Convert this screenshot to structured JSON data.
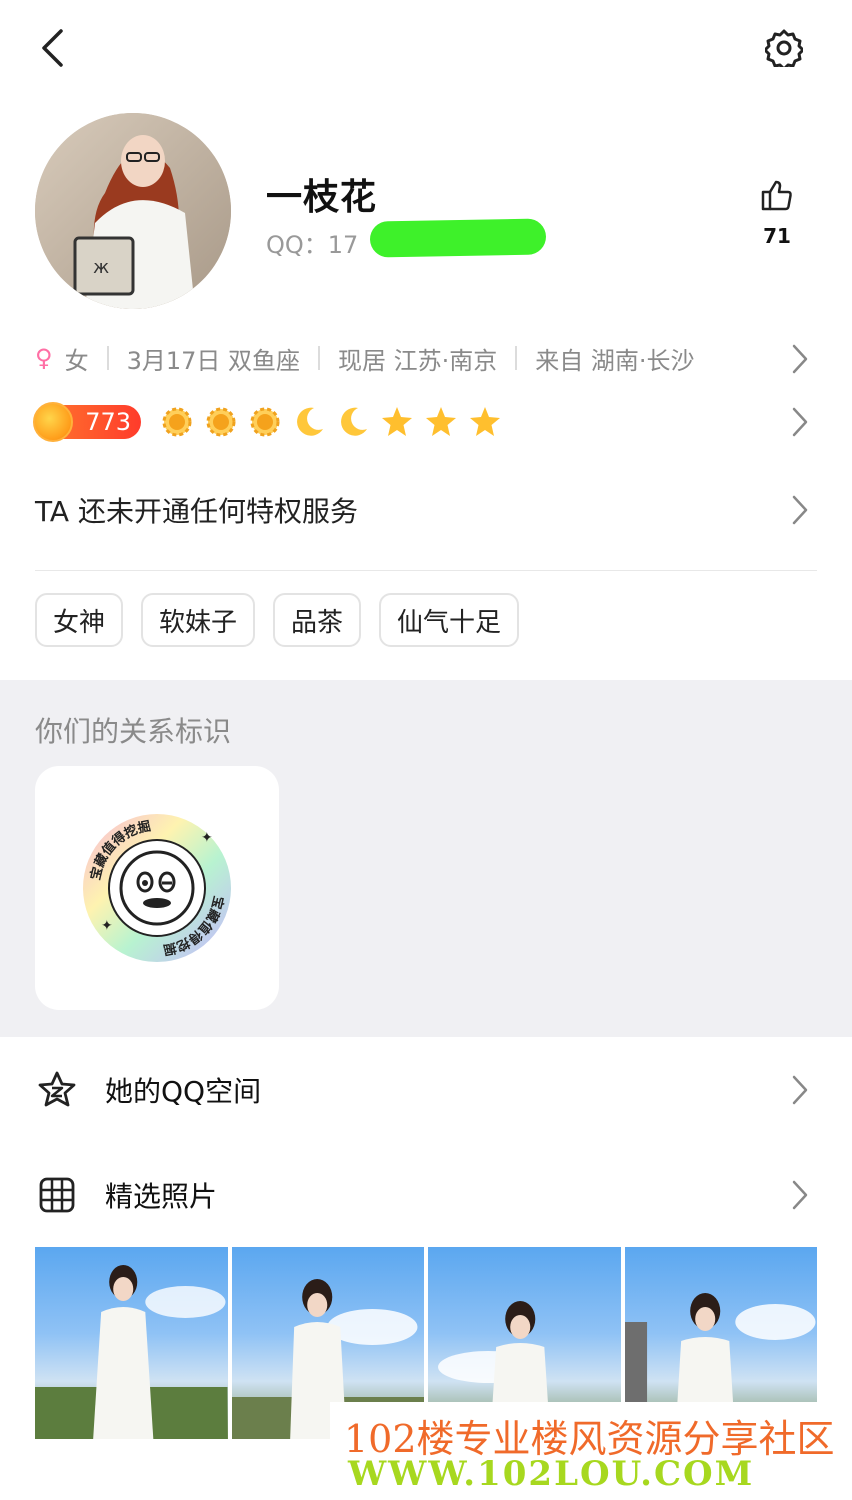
{
  "header": {
    "back_icon": "chevron-left-icon",
    "settings_icon": "gear-icon"
  },
  "profile": {
    "nickname": "一枝花",
    "qq_label": "QQ：",
    "qq_partial": "17",
    "like_count": "71",
    "like_icon": "thumbs-up-icon"
  },
  "info": {
    "gender_icon": "female-icon",
    "gender": "女",
    "birthday": "3月17日 双鱼座",
    "residence": "现居 江苏·南京",
    "hometown": "来自 湖南·长沙"
  },
  "level": {
    "value": "773",
    "icons": [
      "sun",
      "sun",
      "sun",
      "moon",
      "moon",
      "star",
      "star",
      "star"
    ],
    "colors": {
      "badge": "#ff5a2c",
      "icon": "#ffb52e"
    }
  },
  "privilege": {
    "text": "TA 还未开通任何特权服务"
  },
  "tags": [
    "女神",
    "软妹子",
    "品茶",
    "仙气十足"
  ],
  "relation": {
    "title": "你们的关系标识",
    "badge_text": "宝藏值得挖掘"
  },
  "menu": {
    "qzone_label": "她的QQ空间",
    "photos_label": "精选照片"
  },
  "watermark": {
    "line1": "102楼专业楼风资源分享社区",
    "line2": "WWW.102LOU.COM"
  }
}
